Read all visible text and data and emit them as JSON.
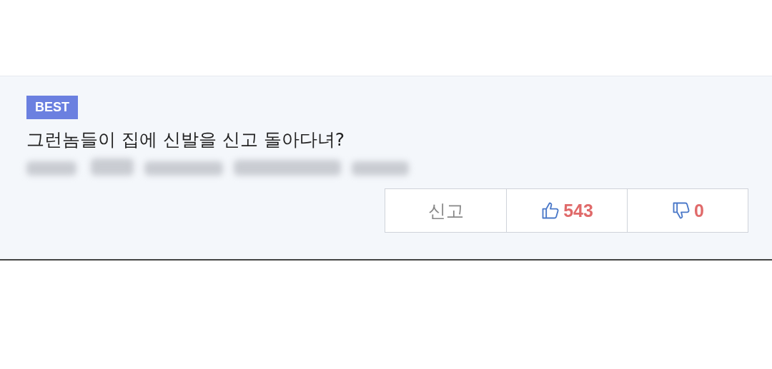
{
  "comment": {
    "badge": "BEST",
    "text": "그런놈들이 집에 신발을 신고 돌아다녀?"
  },
  "actions": [
    {
      "kind": "report",
      "label": "신고"
    },
    {
      "kind": "like",
      "count": "543"
    },
    {
      "kind": "dislike",
      "count": "0"
    }
  ]
}
